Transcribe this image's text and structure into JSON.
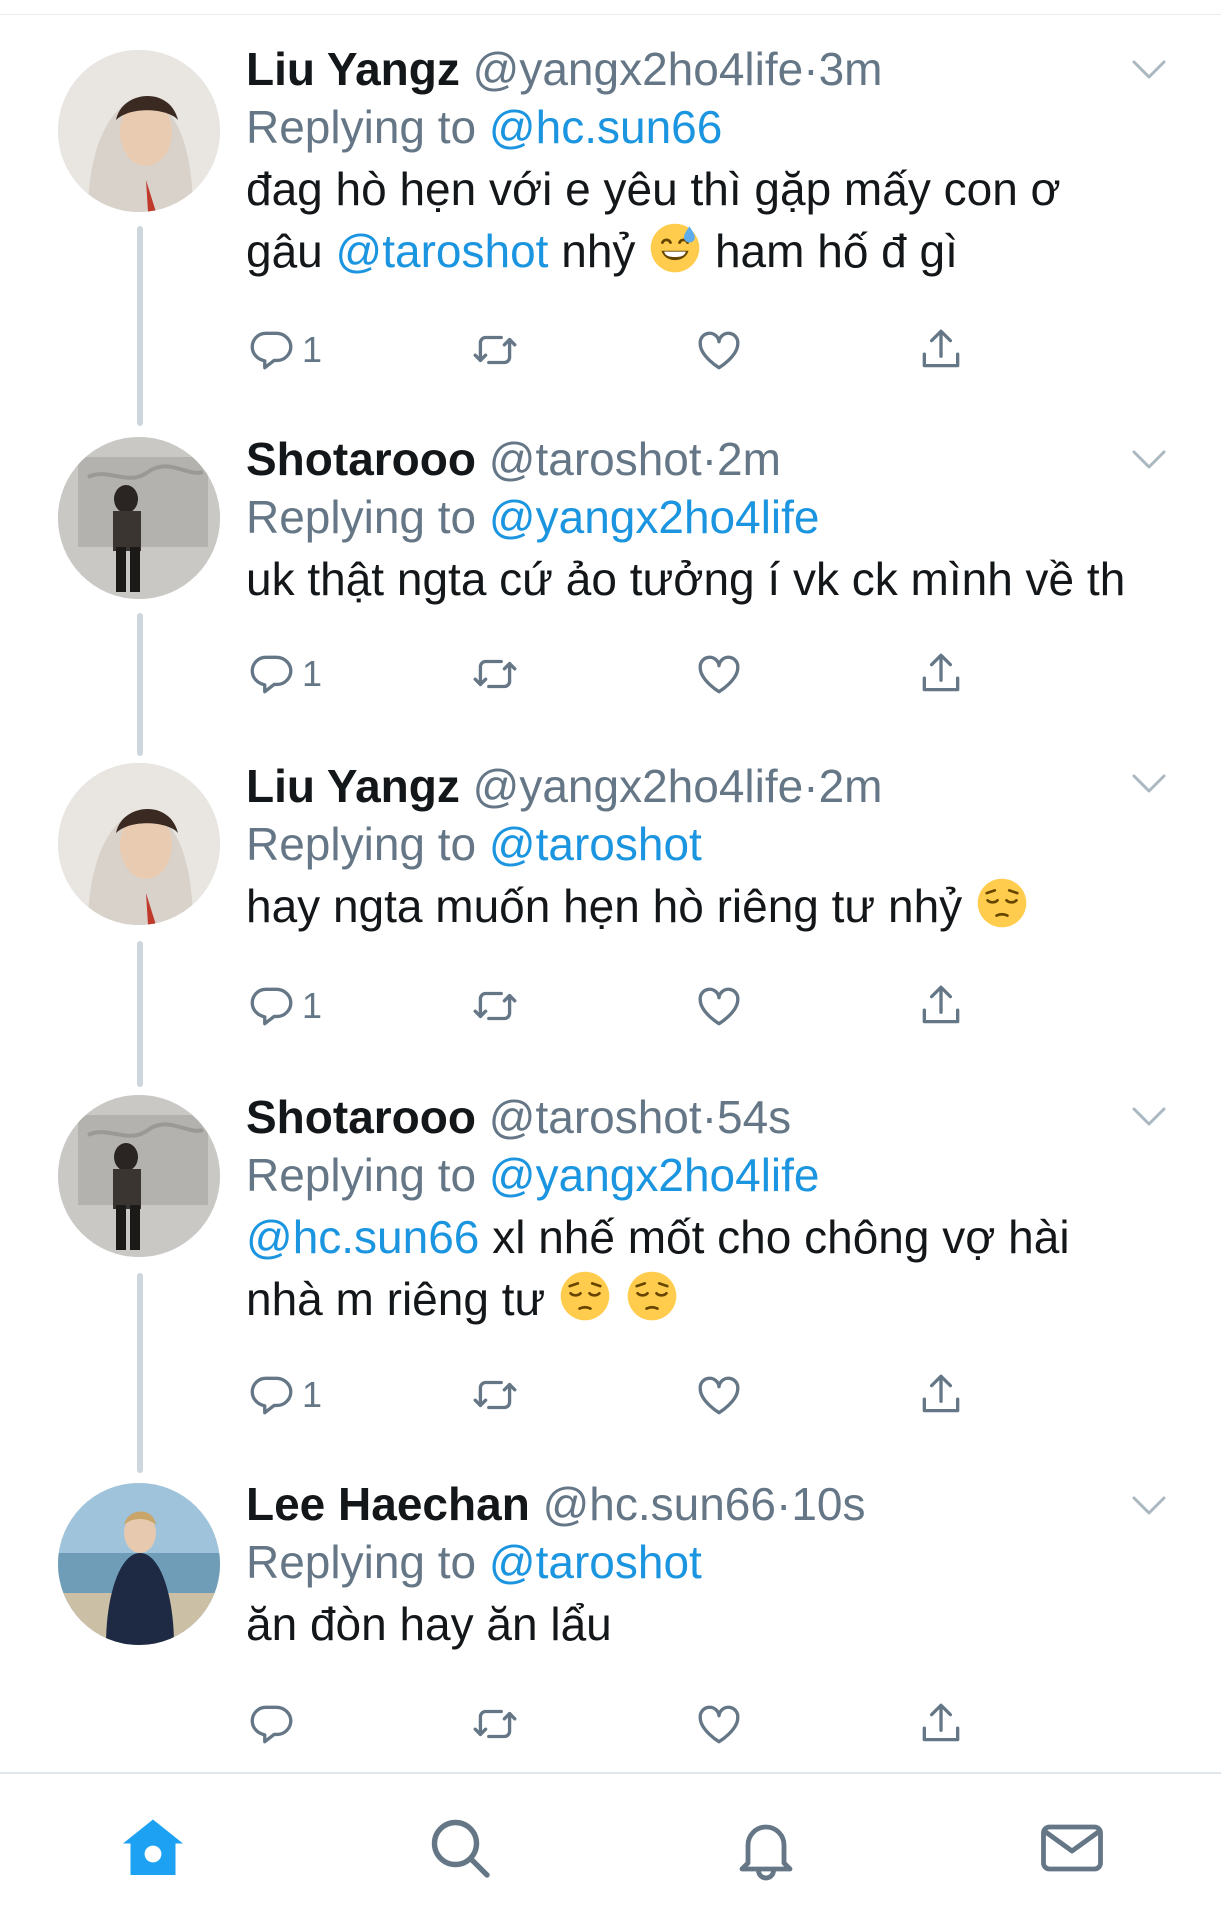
{
  "tweets": [
    {
      "name": "Liu Yangz",
      "handle": "@yangx2ho4life",
      "dot": "·",
      "time": "3m",
      "replying_prefix": "Replying to",
      "replying_to": "@hc.sun66",
      "text_line1": "đag hò hẹn với e yêu thì gặp mấy con ơ",
      "text_line2_pre": "gâu",
      "text_line2_mention": "@taroshot",
      "text_line2_post": "nhỷ",
      "text_line2_end": "ham hố đ gì",
      "reply_count": "1"
    },
    {
      "name": "Shotarooo",
      "handle": "@taroshot",
      "dot": "·",
      "time": "2m",
      "replying_prefix": "Replying to",
      "replying_to": "@yangx2ho4life",
      "text_line1": "uk thật ngta cứ ảo tưởng í vk ck mình về th",
      "reply_count": "1"
    },
    {
      "name": "Liu Yangz",
      "handle": "@yangx2ho4life",
      "dot": "·",
      "time": "2m",
      "replying_prefix": "Replying to",
      "replying_to": "@taroshot",
      "text_line1": "hay ngta muốn hẹn hò riêng tư nhỷ",
      "reply_count": "1"
    },
    {
      "name": "Shotarooo",
      "handle": "@taroshot",
      "dot": "·",
      "time": "54s",
      "replying_prefix": "Replying to",
      "replying_to": "@yangx2ho4life",
      "text_line1_mention": "@hc.sun66",
      "text_line1": "xl nhế mốt cho chông vợ hài",
      "text_line2": "nhà m riêng tư",
      "reply_count": "1"
    },
    {
      "name": "Lee Haechan",
      "handle": "@hc.sun66",
      "dot": "·",
      "time": "10s",
      "replying_prefix": "Replying to",
      "replying_to": "@taroshot",
      "text_line1": "ăn đòn hay ăn lẩu",
      "reply_count": ""
    }
  ],
  "icons": {
    "reply": "reply-icon",
    "retweet": "retweet-icon",
    "like": "heart-icon",
    "share": "share-icon",
    "more": "chevron-down-icon",
    "emoji_sweat": "sweat-smile-emoji",
    "emoji_pensive": "pensive-emoji"
  },
  "tabbar": [
    "home-icon",
    "search-icon",
    "notifications-icon",
    "messages-icon"
  ],
  "colors": {
    "accent": "#1da1f2",
    "mention": "#1b95e0",
    "secondary": "#657786",
    "thread": "#cdd6dd"
  }
}
